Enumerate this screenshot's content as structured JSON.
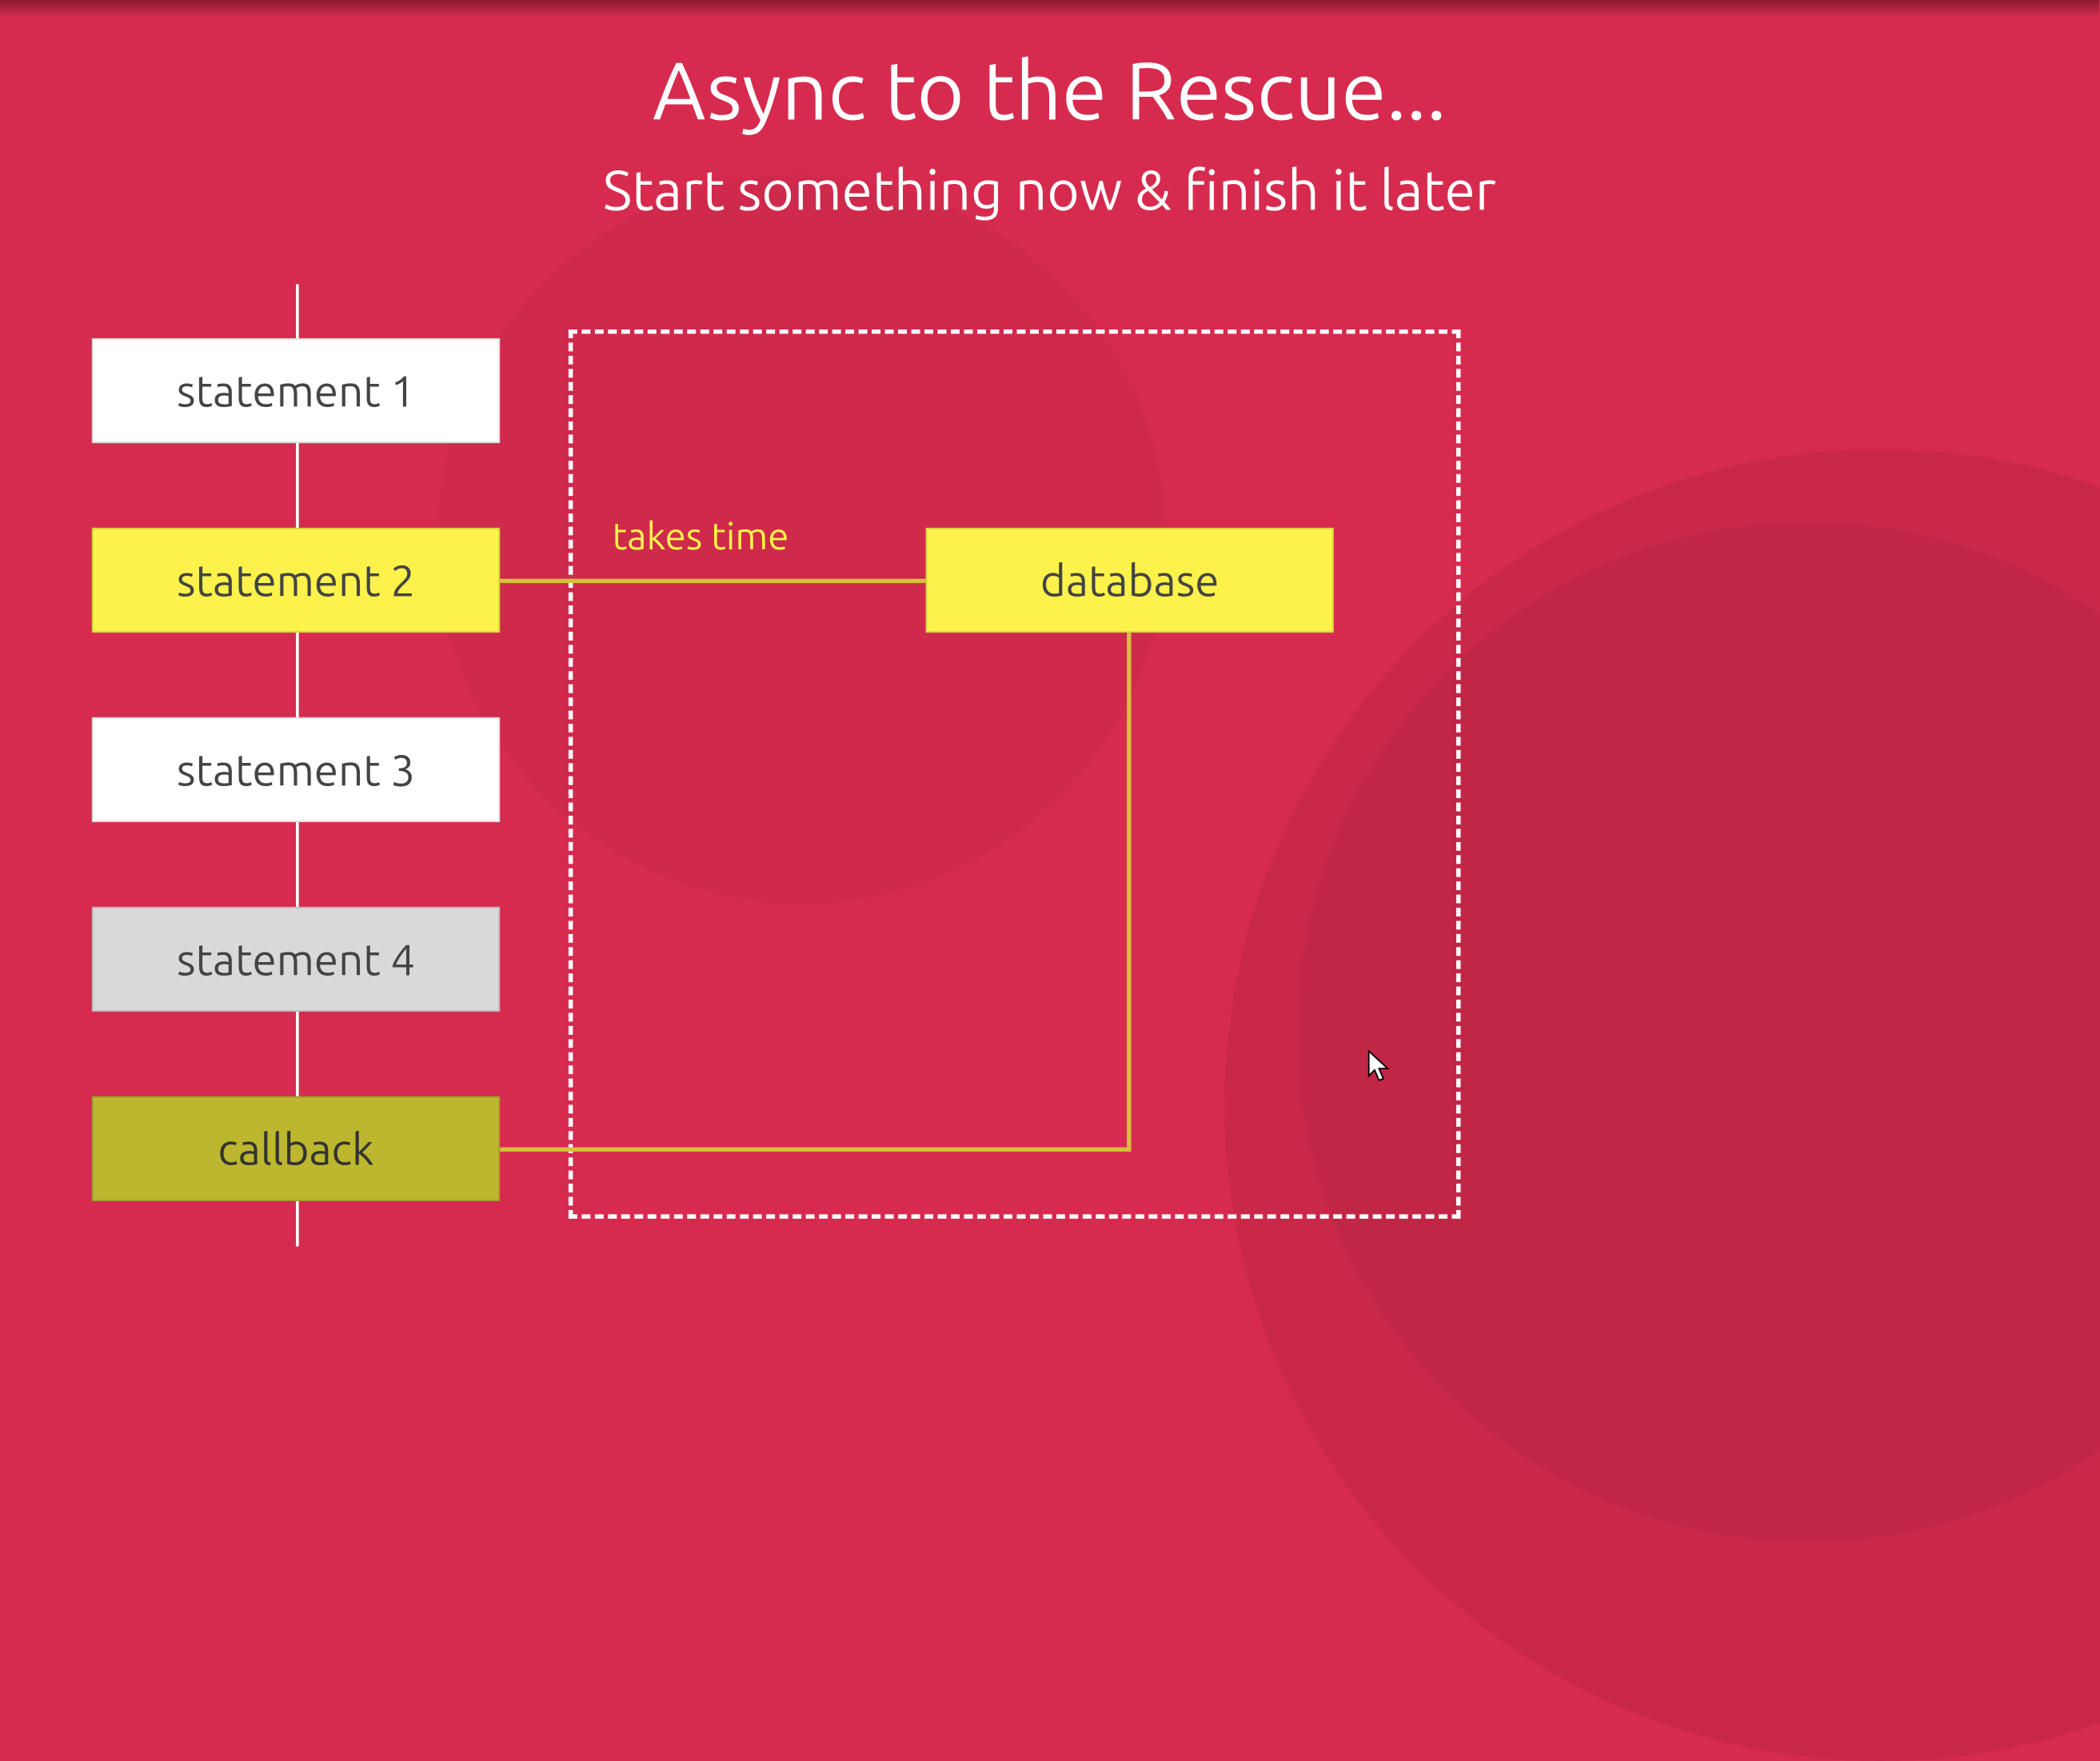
{
  "colors": {
    "background": "#d62b4e",
    "white": "#ffffff",
    "yellow": "#fcf24b",
    "grey": "#d9d9d9",
    "olive": "#bcb72f",
    "connector": "#d6c03a"
  },
  "slide": {
    "title": "Async to the Rescue...",
    "subtitle": "Start something now & finish it later"
  },
  "takes_time_label": "takes time",
  "boxes": {
    "statement1": "statement 1",
    "statement2": "statement 2",
    "statement3": "statement 3",
    "statement4": "statement 4",
    "callback": "callback",
    "database": "database"
  }
}
